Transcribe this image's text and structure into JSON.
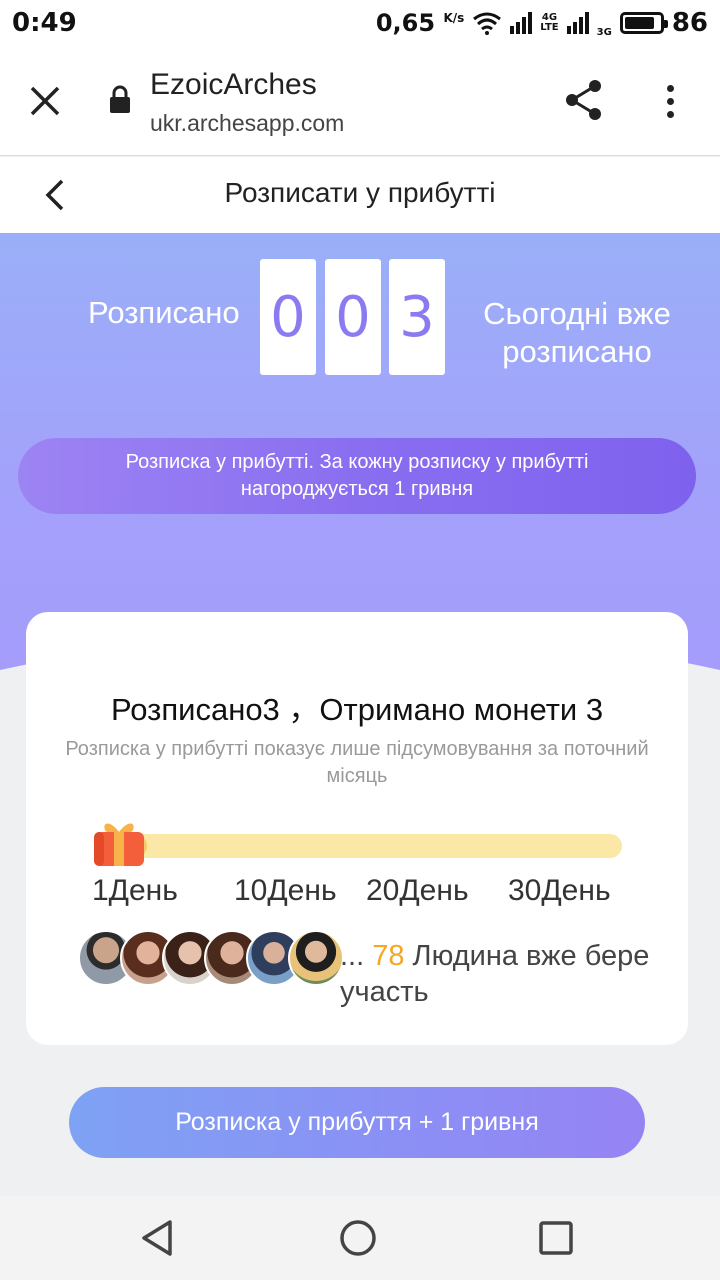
{
  "status_bar": {
    "time": "0:49",
    "speed": "0,65",
    "speed_unit": "K/s",
    "net_4g": "4G",
    "net_lte": "LTE",
    "net_3g": "3G",
    "battery": "86"
  },
  "browser": {
    "site_title": "EzoicArches",
    "url": "ukr.archesapp.com"
  },
  "page": {
    "title": "Розписати у прибутті"
  },
  "counter": {
    "left_label": "Розписано",
    "digits": [
      "0",
      "0",
      "3"
    ],
    "right_label": "Сьогодні вже розписано",
    "digit_color": "#8b7bf0"
  },
  "info_banner": "Розписка у прибутті. За кожну розписку у прибутті нагороджується 1 гривня",
  "card": {
    "title": "Розписано3 ，Отримано монети 3",
    "note": "Розписка у прибутті показує лише підсумовування за поточний місяць",
    "progress_days_completed": 3,
    "progress_days_total": 30,
    "day_labels": [
      "1День",
      "10День",
      "20День",
      "30День"
    ],
    "participants_prefix": "... ",
    "participants_count": "78",
    "participants_suffix": " Людина вже бере участь",
    "count_color": "#f5a623"
  },
  "cta_button": "Розписка у прибуття + 1 гривня"
}
